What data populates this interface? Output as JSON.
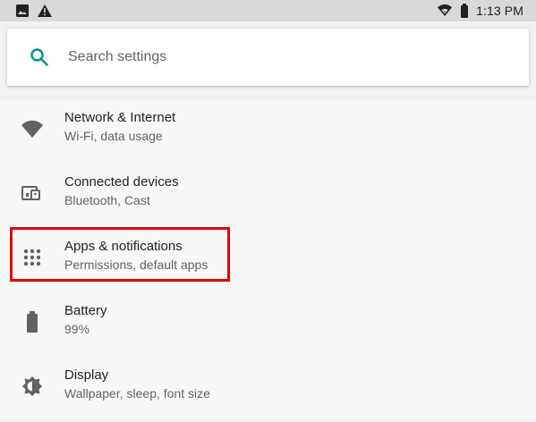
{
  "status_bar": {
    "time": "1:13 PM",
    "left_icons": [
      "image-icon",
      "warning-icon"
    ],
    "right_icons": [
      "wifi-icon",
      "battery-icon"
    ]
  },
  "search": {
    "placeholder": "Search settings",
    "icon": "search-icon",
    "accent_color": "#009688"
  },
  "settings": {
    "items": [
      {
        "title": "Network & Internet",
        "subtitle": "Wi-Fi, data usage",
        "icon": "wifi-icon"
      },
      {
        "title": "Connected devices",
        "subtitle": "Bluetooth, Cast",
        "icon": "devices-icon"
      },
      {
        "title": "Apps & notifications",
        "subtitle": "Permissions, default apps",
        "icon": "apps-grid-icon"
      },
      {
        "title": "Battery",
        "subtitle": "99%",
        "icon": "battery-icon"
      },
      {
        "title": "Display",
        "subtitle": "Wallpaper, sleep, font size",
        "icon": "brightness-icon"
      }
    ]
  },
  "highlight": {
    "item": "Apps & notifications",
    "color": "#e50000"
  }
}
